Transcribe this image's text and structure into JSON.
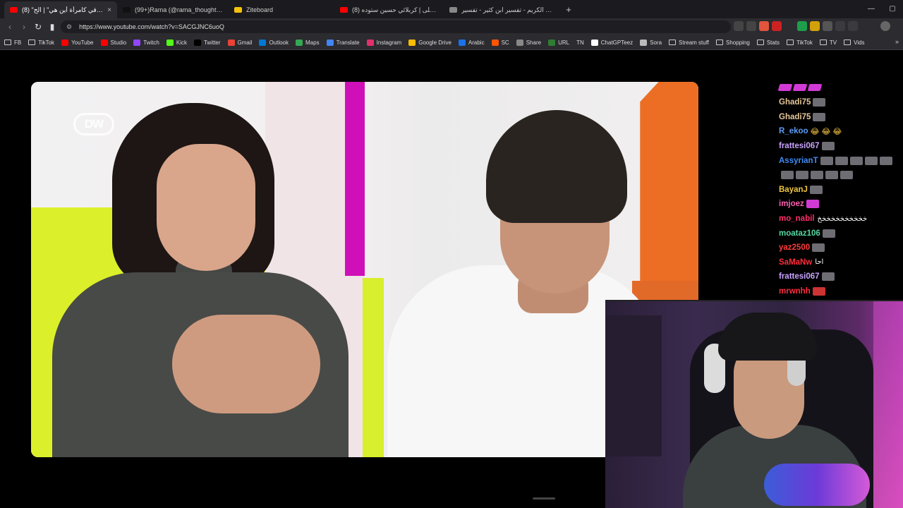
{
  "tabs": [
    {
      "title": "(8) \"حقوقي كامرأة أين هي\" | الح...",
      "active": true,
      "fav_color": "#ff0000"
    },
    {
      "title": "(99+)Rama (@rama_thoughts) | TikT...",
      "active": false,
      "fav_color": "#111111"
    },
    {
      "title": "Ziteboard",
      "active": false,
      "fav_color": "#f4c20d"
    },
    {
      "title": "(8) ثبار على | كربلائي حسين ستوده |...",
      "active": false,
      "fav_color": "#ff0000"
    },
    {
      "title": "القرآن الكريم - تفسير ابن كثير - تفسير...",
      "active": false,
      "fav_color": "#888888"
    }
  ],
  "newtab_label": "+",
  "window_controls": [
    "—",
    "▢"
  ],
  "url": "https://www.youtube.com/watch?v=SACGJNC6uoQ",
  "bookmarks": [
    {
      "label": "FB",
      "type": "folder"
    },
    {
      "label": "TikTok",
      "type": "folder"
    },
    {
      "label": "YouTube",
      "type": "icon",
      "color": "#ff0000"
    },
    {
      "label": "Studio",
      "type": "icon",
      "color": "#ff0000"
    },
    {
      "label": "Twitch",
      "type": "icon",
      "color": "#9146ff"
    },
    {
      "label": "Kick",
      "type": "icon",
      "color": "#53fc18"
    },
    {
      "label": "Twitter",
      "type": "icon",
      "color": "#000000"
    },
    {
      "label": "Gmail",
      "type": "icon",
      "color": "#ea4335"
    },
    {
      "label": "Outlook",
      "type": "icon",
      "color": "#0078d4"
    },
    {
      "label": "Maps",
      "type": "icon",
      "color": "#34a853"
    },
    {
      "label": "Translate",
      "type": "icon",
      "color": "#4285f4"
    },
    {
      "label": "Instagram",
      "type": "icon",
      "color": "#e1306c"
    },
    {
      "label": "Google Drive",
      "type": "icon",
      "color": "#fbbc04"
    },
    {
      "label": "Arabic",
      "type": "icon",
      "color": "#1a73e8"
    },
    {
      "label": "SC",
      "type": "icon",
      "color": "#ff5500"
    },
    {
      "label": "Share",
      "type": "icon",
      "color": "#888888"
    },
    {
      "label": "URL",
      "type": "icon",
      "color": "#2e7d32"
    },
    {
      "label": "TN",
      "type": "text"
    },
    {
      "label": "ChatGPTeez",
      "type": "icon",
      "color": "#ffffff"
    },
    {
      "label": "Sora",
      "type": "icon",
      "color": "#bbbbbb"
    },
    {
      "label": "Stream stuff",
      "type": "folder"
    },
    {
      "label": "Shopping",
      "type": "folder"
    },
    {
      "label": "Stats",
      "type": "folder"
    },
    {
      "label": "TikTok",
      "type": "folder"
    },
    {
      "label": "TV",
      "type": "folder"
    },
    {
      "label": "Vids",
      "type": "folder"
    }
  ],
  "bookmarks_more": "»",
  "video": {
    "logo_text": "DW"
  },
  "chat": [
    {
      "user": "Ghadi75",
      "color": "#e6c79a",
      "emotes": [
        "grey"
      ],
      "text": ""
    },
    {
      "user": "Ghadi75",
      "color": "#e6c79a",
      "emotes": [
        "grey"
      ],
      "text": ""
    },
    {
      "user": "R_ekoo",
      "color": "#5b9cf6",
      "emotes": [],
      "text": "",
      "emoji": "😂 😂 😂"
    },
    {
      "user": "frattesi067",
      "color": "#c9a3ff",
      "emotes": [
        "grey"
      ],
      "text": ""
    },
    {
      "user": "AssyrianT",
      "color": "#3f8cf5",
      "emotes": [
        "grey",
        "grey",
        "grey",
        "grey",
        "grey"
      ],
      "text": ""
    },
    {
      "user": "",
      "color": "#3f8cf5",
      "emotes": [
        "grey",
        "grey",
        "grey",
        "grey",
        "grey"
      ],
      "text": ""
    },
    {
      "user": "BayanJ",
      "color": "#f0c63f",
      "emotes": [
        "grey"
      ],
      "text": ""
    },
    {
      "user": "imjoez",
      "color": "#ff5fb0",
      "emotes": [
        "pink"
      ],
      "text": ""
    },
    {
      "user": "mo_nabil",
      "color": "#ff2d6a",
      "emotes": [],
      "text": "خخخخخخخخخخخ"
    },
    {
      "user": "moataz106",
      "color": "#55d6a0",
      "emotes": [
        "grey"
      ],
      "text": ""
    },
    {
      "user": "yaz2500",
      "color": "#ff3b3b",
      "emotes": [
        "grey"
      ],
      "text": ""
    },
    {
      "user": "SaMaNw",
      "color": "#ff2d3d",
      "emotes": [],
      "text": "احا"
    },
    {
      "user": "frattesi067",
      "color": "#c9a3ff",
      "emotes": [
        "grey"
      ],
      "text": ""
    },
    {
      "user": "mrwnhh",
      "color": "#ff2d3d",
      "emotes": [
        "red"
      ],
      "text": ""
    }
  ]
}
